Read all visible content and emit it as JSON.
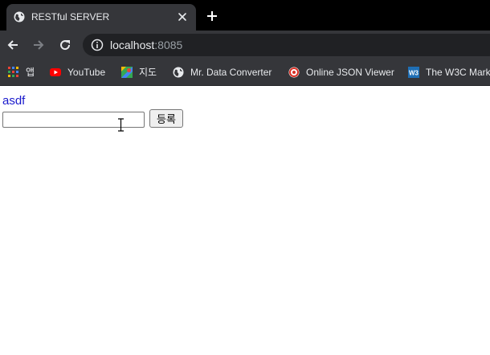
{
  "browser": {
    "tab": {
      "title": "RESTful SERVER"
    },
    "address": {
      "host": "localhost",
      "port": ":8085"
    },
    "bookmarks": [
      {
        "label": "앱",
        "icon": "apps-grid-icon"
      },
      {
        "label": "YouTube",
        "icon": "youtube-icon"
      },
      {
        "label": "지도",
        "icon": "maps-icon"
      },
      {
        "label": "Mr. Data Converter",
        "icon": "globe-icon"
      },
      {
        "label": "Online JSON Viewer",
        "icon": "json-viewer-icon"
      },
      {
        "label": "The W3C Mark",
        "icon": "w3c-icon"
      }
    ]
  },
  "page": {
    "link_text": "asdf",
    "input_value": "",
    "submit_label": "등록"
  },
  "colors": {
    "tab_strip": "#000000",
    "toolbar": "#35363a",
    "omnibox": "#202124",
    "link": "#1a1acc"
  }
}
